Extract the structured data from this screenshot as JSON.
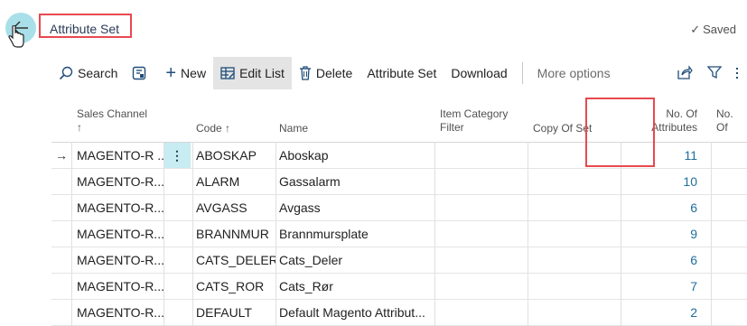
{
  "header": {
    "title": "Attribute Set",
    "saved": "Saved"
  },
  "toolbar": {
    "search": "Search",
    "new": "New",
    "edit_list": "Edit List",
    "delete": "Delete",
    "attribute_set": "Attribute Set",
    "download": "Download",
    "more_options": "More options"
  },
  "columns": {
    "sales_channel": "Sales Channel",
    "sort_arrow": "↑",
    "code": "Code ↑",
    "name": "Name",
    "item_category_1": "Item Category",
    "item_category_2": "Filter",
    "copy_of_set": "Copy Of Set",
    "no_attr_1": "No. Of",
    "no_attr_2": "Attributes",
    "no_of": "No. Of"
  },
  "rows": [
    {
      "channel": "MAGENTO-R ...",
      "code": "ABOSKAP",
      "name": "Aboskap",
      "attributes": "11"
    },
    {
      "channel": "MAGENTO-R...",
      "code": "ALARM",
      "name": "Gassalarm",
      "attributes": "10"
    },
    {
      "channel": "MAGENTO-R...",
      "code": "AVGASS",
      "name": "Avgass",
      "attributes": "6"
    },
    {
      "channel": "MAGENTO-R...",
      "code": "BRANNMUR",
      "name": "Brannmursplate",
      "attributes": "9"
    },
    {
      "channel": "MAGENTO-R...",
      "code": "CATS_DELER",
      "name": "Cats_Deler",
      "attributes": "6"
    },
    {
      "channel": "MAGENTO-R...",
      "code": "CATS_ROR",
      "name": "Cats_Rør",
      "attributes": "7"
    },
    {
      "channel": "MAGENTO-R...",
      "code": "DEFAULT",
      "name": "Default Magento Attribut...",
      "attributes": "2"
    }
  ],
  "current_row_marker": "→",
  "row_menu": "⋮",
  "colors": {
    "accent": "#a9dfe8",
    "highlight": "#e8494f",
    "link": "#1f6e9c"
  }
}
